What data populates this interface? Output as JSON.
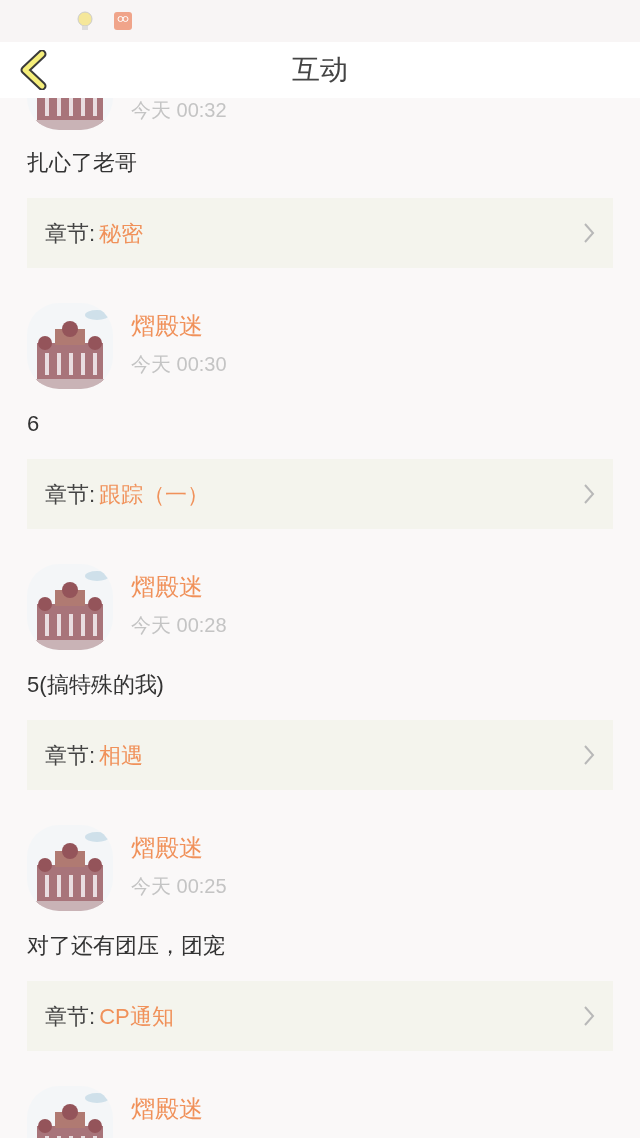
{
  "header": {
    "title": "互动"
  },
  "items": [
    {
      "time": "今天 00:32",
      "comment": "扎心了老哥",
      "chapter_label": "章节:",
      "chapter": "秘密"
    },
    {
      "name": "熠殿迷",
      "time": "今天 00:30",
      "comment": "6",
      "chapter_label": "章节:",
      "chapter": "跟踪（一）"
    },
    {
      "name": "熠殿迷",
      "time": "今天 00:28",
      "comment": "5(搞特殊的我)",
      "chapter_label": "章节:",
      "chapter": "相遇"
    },
    {
      "name": "熠殿迷",
      "time": "今天 00:25",
      "comment": "对了还有团压，团宠",
      "chapter_label": "章节:",
      "chapter": "CP通知"
    },
    {
      "name": "熠殿迷"
    }
  ]
}
